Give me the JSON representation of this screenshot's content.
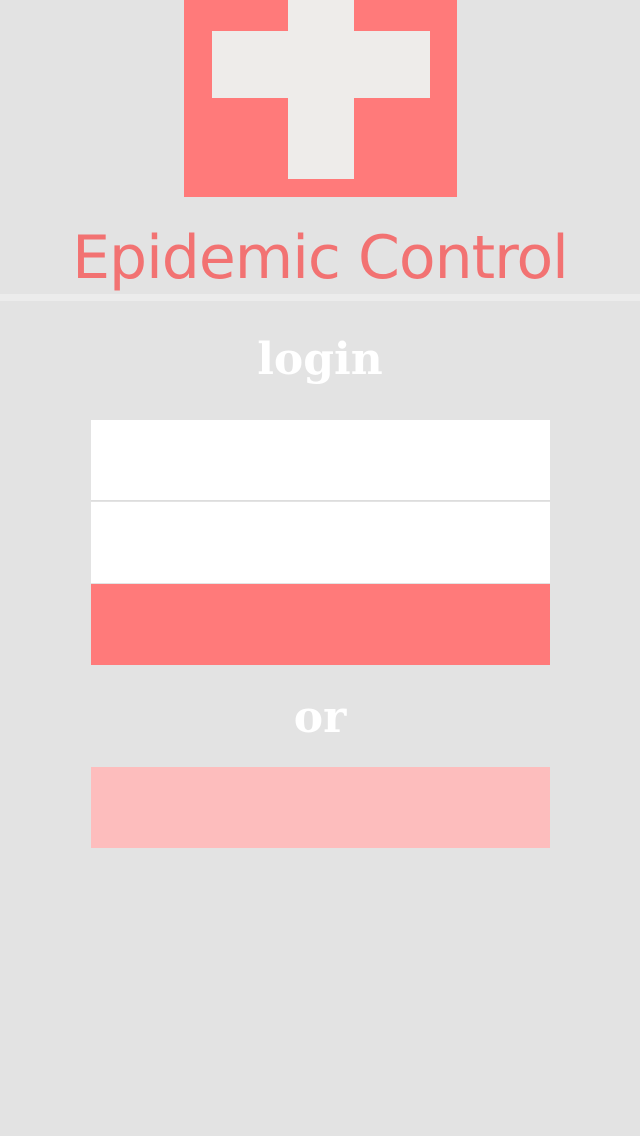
{
  "app": {
    "title": "Epidemic Control",
    "logo_icon": "medical-cross-icon",
    "brand_color": "#ff7a7a",
    "title_color": "#f27272",
    "background_color": "#e3e3e3"
  },
  "login": {
    "heading": "login",
    "field_1": {
      "value": "",
      "placeholder": ""
    },
    "field_2": {
      "value": "",
      "placeholder": ""
    },
    "submit_label": "",
    "submit_color": "#ff7a7a"
  },
  "separator": {
    "text": "or"
  },
  "alternate": {
    "button_label": "",
    "button_color": "#fdbdbd"
  }
}
